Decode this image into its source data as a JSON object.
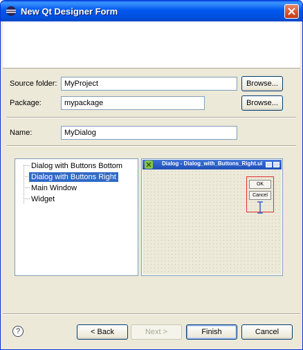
{
  "window": {
    "title": "New Qt Designer Form"
  },
  "form": {
    "source_folder_label": "Source folder:",
    "source_folder_value": "MyProject",
    "package_label": "Package:",
    "package_value": "mypackage",
    "name_label": "Name:",
    "name_value": "MyDialog",
    "browse_label": "Browse..."
  },
  "templates": {
    "items": [
      {
        "label": "Dialog with Buttons Bottom",
        "selected": false
      },
      {
        "label": "Dialog with Buttons Right",
        "selected": true
      },
      {
        "label": "Main Window",
        "selected": false
      },
      {
        "label": "Widget",
        "selected": false
      }
    ]
  },
  "preview": {
    "title": "Dialog - Dialog_with_Buttons_Right.ui",
    "ok_label": "OK",
    "cancel_label": "Cancel"
  },
  "footer": {
    "back_label": "< Back",
    "next_label": "Next >",
    "finish_label": "Finish",
    "cancel_label": "Cancel",
    "help_symbol": "?"
  },
  "colors": {
    "title_bar": "#0058ee",
    "selection": "#316ac5",
    "close_button": "#d5512a"
  }
}
